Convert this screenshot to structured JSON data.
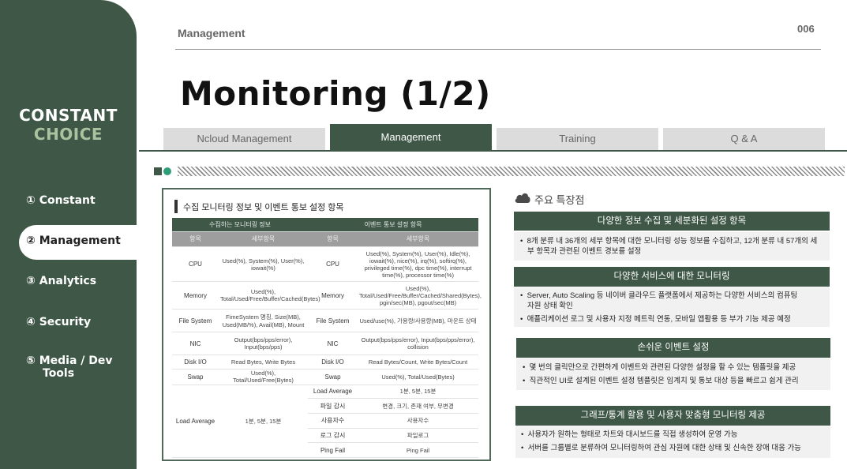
{
  "sidebar": {
    "brand_line1": "CONSTANT",
    "brand_line2": "CHOICE",
    "items": [
      {
        "label": "① Constant"
      },
      {
        "label": "② Management"
      },
      {
        "label": "③ Analytics"
      },
      {
        "label": "④ Security"
      },
      {
        "label": "⑤ Media / Dev"
      },
      {
        "label": "Tools"
      }
    ]
  },
  "header": {
    "breadcrumb": "Management",
    "page_number": "006",
    "title": "Monitoring (1/2)"
  },
  "tabs": [
    {
      "label": "Ncloud Management"
    },
    {
      "label": "Management"
    },
    {
      "label": "Training"
    },
    {
      "label": "Q & A"
    }
  ],
  "panel": {
    "title": "수집 모니터링 정보 및 이벤트 통보 설정 항목",
    "section_left": "수집하는 모니터링 정보",
    "section_right": "이벤트 통보 설정 항목",
    "col_item": "항목",
    "col_detail": "세부항목",
    "rows": [
      {
        "item": "CPU",
        "metrics": "Used(%), System(%), User(%), iowait(%)",
        "event_item": "CPU",
        "event": "Used(%), System(%), User(%), Idle(%), iowait(%), nice(%), irq(%), softirq(%), privileged time(%), dpc time(%), interrupt time(%), processor time(%)"
      },
      {
        "item": "Memory",
        "metrics": "Used(%), Total/Used/Free/Buffer/Cached(Bytes)",
        "event_item": "Memory",
        "event": "Used(%), Total/Used/Free/Buffer/Cached/Shared(Bytes), pgin/sec(MB), pgout/sec(MB)"
      },
      {
        "item": "File System",
        "metrics": "FimeSystem 명칭, Size(MB), Used(MB/%), Avail(MB), Mount",
        "event_item": "File System",
        "event": "Used/use(%), 가용량/사용량(MB), 마운트 상태"
      },
      {
        "item": "NIC",
        "metrics": "Output(bps/pps/error), Input(bps/pps)",
        "event_item": "NIC",
        "event": "Output(bps/pps/error), Input(bps/pps/error), collision"
      },
      {
        "item": "Disk I/O",
        "metrics": "Read Bytes, Write Bytes",
        "event_item": "Disk I/O",
        "event": "Read Bytes/Count, Write Bytes/Count"
      },
      {
        "item": "Swap",
        "metrics": "Used(%), Total/Used/Free(Bytes)",
        "event_item": "Swap",
        "event": "Used(%), Total/Used(Bytes)"
      }
    ],
    "load_average": {
      "item": "Load Average",
      "metrics": "1분, 5분, 15분",
      "events": [
        {
          "item": "Load Average",
          "detail": "1분, 5분, 15분"
        },
        {
          "item": "파일 감시",
          "detail": "변경, 크기, 존재 여부, 무변경"
        },
        {
          "item": "사용자수",
          "detail": "사용자수"
        },
        {
          "item": "로그 감시",
          "detail": "파일로그"
        },
        {
          "item": "Ping Fail",
          "detail": "Ping Fail"
        }
      ]
    }
  },
  "features": {
    "heading": "주요 특장점",
    "blocks": [
      {
        "title": "다양한 정보 수집 및 세분화된 설정 항목",
        "bullets": [
          "8개 분류 내 36개의 세부 항목에 대한 모니터링 성능 정보를 수집하고, 12개 분류 내 57개의 세",
          "부 항목과 관련된 이벤트 경보를 설정"
        ]
      },
      {
        "title": "다양한 서비스에 대한 모니터링",
        "bullets": [
          "Server, Auto Scaling 등 네이버 클라우드 플랫폼에서 제공하는 다양한 서비스의 컴퓨팅",
          "자원 상태 확인",
          "애플리케이션 로그 및 사용자 지정 메트릭 연동, 모바일 앱활용 등 부가 기능 제공 예정"
        ]
      },
      {
        "title": "손쉬운 이벤트 설정",
        "bullets": [
          "몇 번의 클릭만으로 간편하게 이벤트와 관련된 다양한 설정을 할 수 있는 템플릿을 제공",
          "직관적인 UI로 설계된 이벤트 설정 템플릿은 임계치 및 통보 대상 등을 빠르고 쉽게 관리"
        ]
      },
      {
        "title": "그래프/통계 활용 및 사용자 맞춤형 모니터링 제공",
        "bullets": [
          "사용자가 원하는 형태로 차트와 대시보드를 직접 생성하여 운영 가능",
          "서버를 그룹별로 분류하여 모니터링하여 관심 자원에 대한 상태 및 신속한 장애 대응 가능"
        ]
      }
    ]
  },
  "colors": {
    "primary": "#3f5747",
    "accent": "#a9c2a0",
    "dot": "#2e9e7a",
    "tab_inactive": "#dcdcdc"
  }
}
